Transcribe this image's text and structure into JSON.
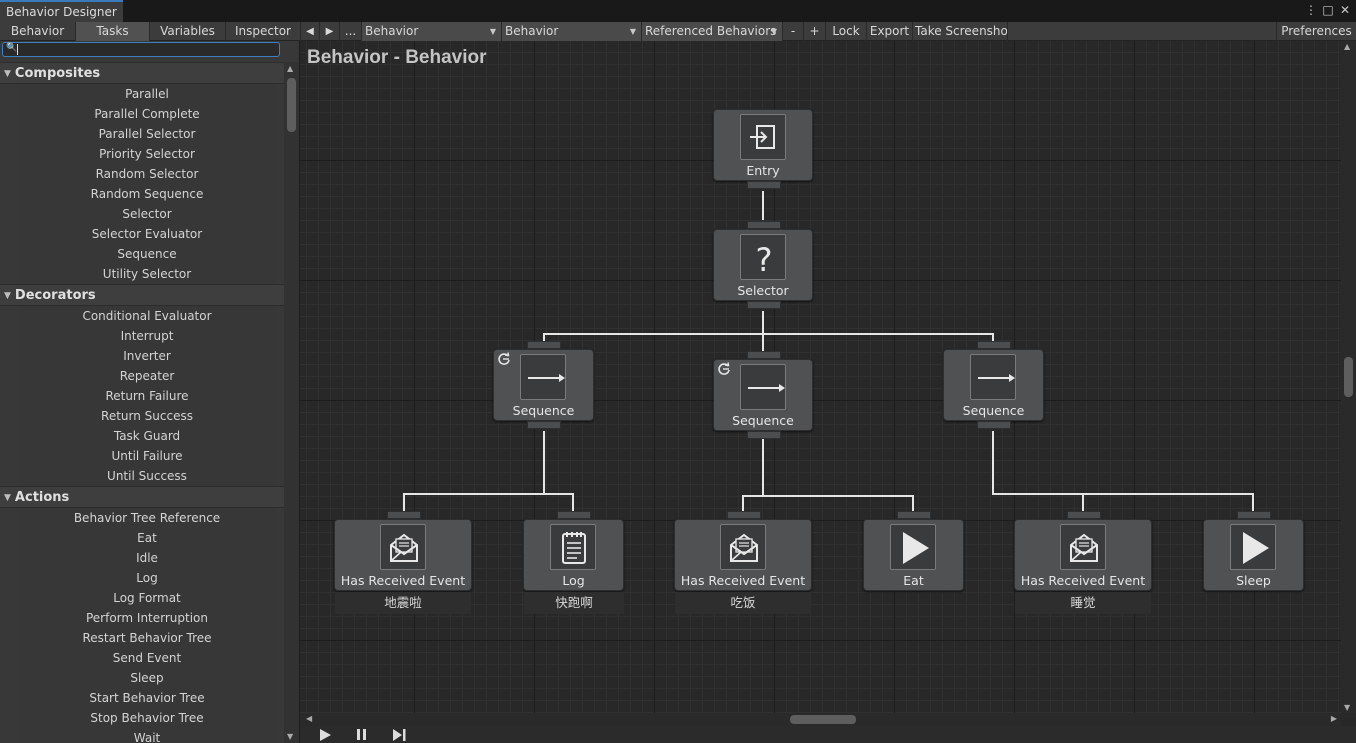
{
  "window": {
    "title": "Behavior Designer"
  },
  "toolbar": {
    "tabs": [
      "Behavior",
      "Tasks",
      "Variables",
      "Inspector"
    ],
    "active_tab": "Tasks",
    "prev_label": "◀",
    "next_label": "▶",
    "ellipsis_label": "...",
    "object_dropdown": "Behavior",
    "behavior_dropdown": "Behavior",
    "referenced_dropdown": "Referenced Behaviors",
    "minus_label": "-",
    "plus_label": "+",
    "lock_label": "Lock",
    "export_label": "Export",
    "screenshot_label": "Take Screenshot",
    "preferences_label": "Preferences"
  },
  "search": {
    "value": ""
  },
  "task_list": {
    "categories": [
      {
        "name": "Composites",
        "items": [
          "Parallel",
          "Parallel Complete",
          "Parallel Selector",
          "Priority Selector",
          "Random Selector",
          "Random Sequence",
          "Selector",
          "Selector Evaluator",
          "Sequence",
          "Utility Selector"
        ]
      },
      {
        "name": "Decorators",
        "items": [
          "Conditional Evaluator",
          "Interrupt",
          "Inverter",
          "Repeater",
          "Return Failure",
          "Return Success",
          "Task Guard",
          "Until Failure",
          "Until Success"
        ]
      },
      {
        "name": "Actions",
        "items": [
          "Behavior Tree Reference",
          "Eat",
          "Idle",
          "Log",
          "Log Format",
          "Perform Interruption",
          "Restart Behavior Tree",
          "Send Event",
          "Sleep",
          "Start Behavior Tree",
          "Stop Behavior Tree",
          "Wait"
        ]
      }
    ]
  },
  "graph": {
    "title": "Behavior - Behavior",
    "nodes": {
      "entry": {
        "label": "Entry",
        "icon": "entry-icon"
      },
      "selector": {
        "label": "Selector",
        "icon": "question-icon"
      },
      "sequence_left": {
        "label": "Sequence",
        "icon": "arrow-right-icon"
      },
      "sequence_mid": {
        "label": "Sequence",
        "icon": "arrow-right-icon"
      },
      "sequence_right": {
        "label": "Sequence",
        "icon": "arrow-right-icon"
      },
      "event1": {
        "label": "Has Received Event",
        "comment": "地震啦",
        "icon": "envelope-icon"
      },
      "log1": {
        "label": "Log",
        "comment": "快跑啊",
        "icon": "notepad-icon"
      },
      "event2": {
        "label": "Has Received Event",
        "comment": "吃饭",
        "icon": "envelope-icon"
      },
      "eat": {
        "label": "Eat",
        "icon": "play-icon"
      },
      "event3": {
        "label": "Has Received Event",
        "comment": "睡觉",
        "icon": "envelope-icon"
      },
      "sleep": {
        "label": "Sleep",
        "icon": "play-icon"
      }
    }
  },
  "colors": {
    "accent": "#3a79bb",
    "node_fill": "#4f5153",
    "connection": "#e6e6e6",
    "background": "#282828"
  }
}
